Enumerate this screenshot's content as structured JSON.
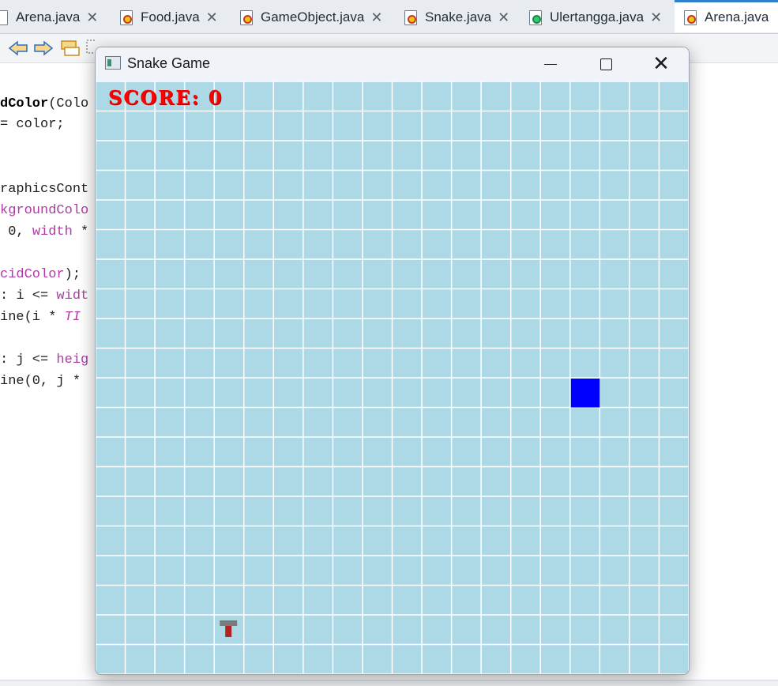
{
  "tabs": [
    {
      "label": "Arena.java",
      "active": false
    },
    {
      "label": "Food.java",
      "active": false
    },
    {
      "label": "GameObject.java",
      "active": false
    },
    {
      "label": "Snake.java",
      "active": false
    },
    {
      "label": "Ulertangga.java",
      "active": false
    },
    {
      "label": "Arena.java",
      "active": true
    }
  ],
  "tab_close_glyph": "✕",
  "code": {
    "line1_kw": "dColor",
    "line1_rest": "(Colo",
    "line2": "= color;",
    "line4": "raphicsCont",
    "line5": "kgroundColo",
    "line6_a": " 0, ",
    "line6_b": "width",
    "line6_c": " *",
    "line8_a": "cidColor",
    "line8_b": ");",
    "line9_a": ": i <= ",
    "line9_b": "widt",
    "line10_a": "ine(i * ",
    "line10_b": "TI",
    "line12_a": ": j <= ",
    "line12_b": "heig",
    "line13": "ine(0, j *"
  },
  "game": {
    "window_title": "Snake Game",
    "minimize_icon": "minimize-icon",
    "maximize_icon": "maximize-icon",
    "close_icon": "close-icon",
    "score_label": "SCORE: 0",
    "score": 0,
    "grid": {
      "cols": 20,
      "rows": 20
    },
    "food": {
      "col": 16,
      "row": 10,
      "color": "#0000ff"
    },
    "snake": {
      "col": 4,
      "row": 18,
      "colors": [
        "#7a7a7a",
        "#b22222"
      ]
    },
    "colors": {
      "background": "#add8e6",
      "grid_line": "#ffffff",
      "score": "#ff0000"
    }
  }
}
